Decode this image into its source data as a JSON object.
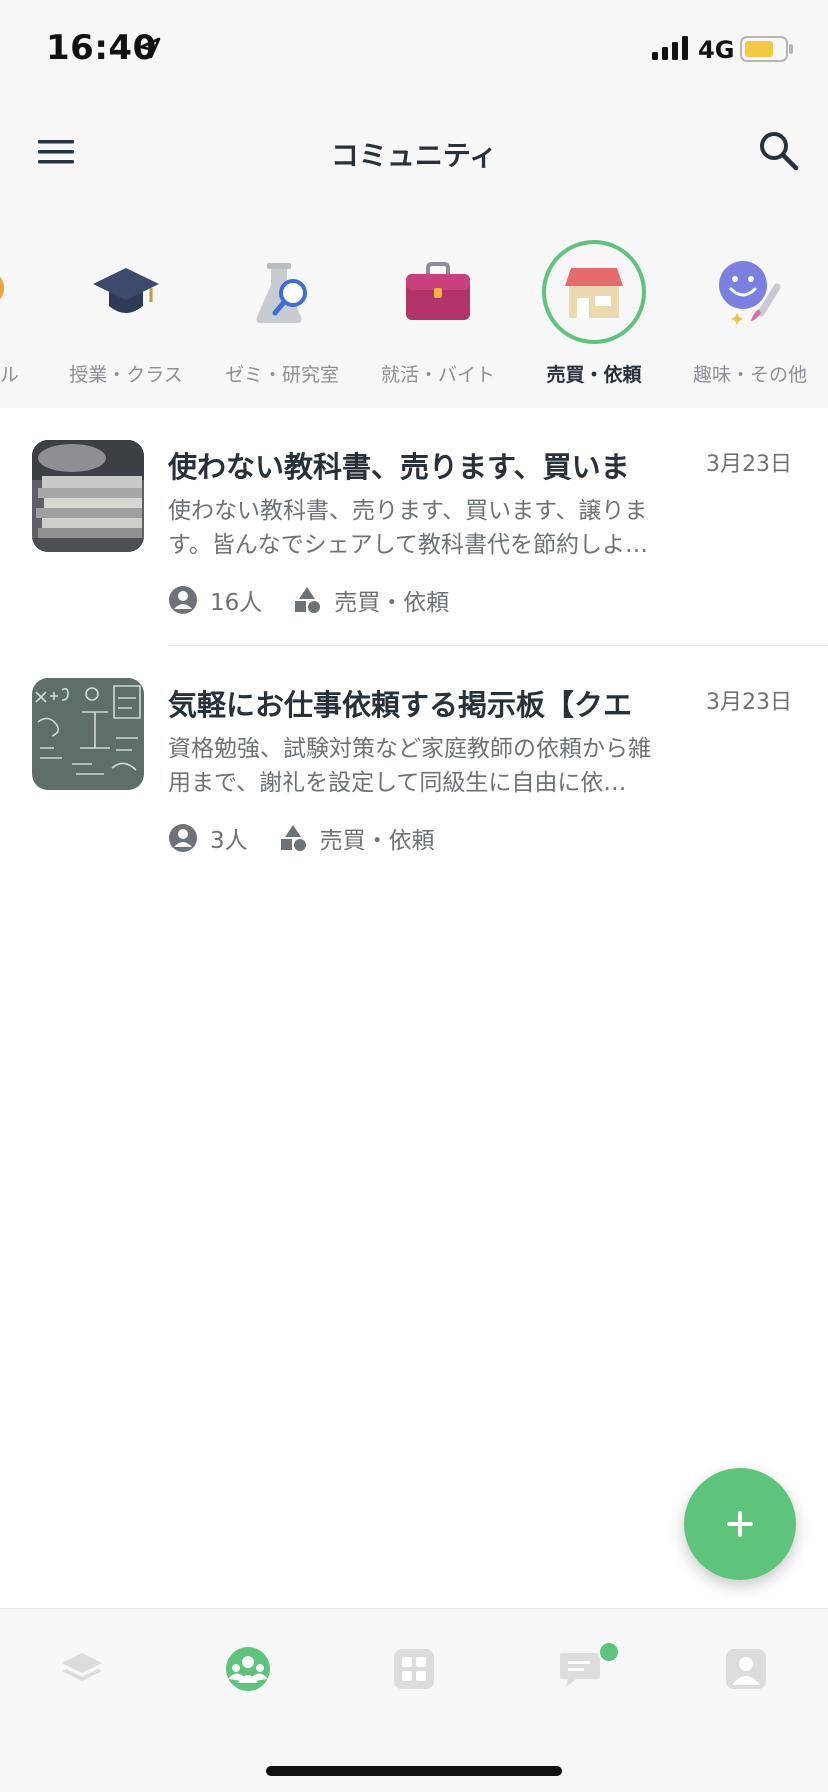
{
  "status_bar": {
    "time": "16:40",
    "network": "4G",
    "battery_color": "#f5c842"
  },
  "header": {
    "title": "コミュニティ",
    "menu_icon": "hamburger-menu-icon",
    "search_icon": "search-icon"
  },
  "categories": {
    "partial_left_label": "ル",
    "items": [
      {
        "label": "授業・クラス",
        "icon": "graduation-cap-icon",
        "active": false
      },
      {
        "label": "ゼミ・研究室",
        "icon": "flask-magnifier-icon",
        "active": false
      },
      {
        "label": "就活・バイト",
        "icon": "briefcase-icon",
        "active": false
      },
      {
        "label": "売買・依頼",
        "icon": "shop-icon",
        "active": true
      },
      {
        "label": "趣味・その他",
        "icon": "smiley-paintbrush-icon",
        "active": false
      }
    ]
  },
  "communities": [
    {
      "title": "使わない教科書、売ります、買いま",
      "date": "3月23日",
      "description": "使わない教科書、売ります、買います、譲ります。皆んなでシェアして教科書代を節約しよ…",
      "members": "16人",
      "category": "売買・依頼",
      "thumbnail": "stack-of-books-thumbnail"
    },
    {
      "title": "気軽にお仕事依頼する掲示板【クエ",
      "date": "3月23日",
      "description": "資格勉強、試験対策など家庭教師の依頼から雑用まで、謝礼を設定して同級生に自由に依…",
      "members": "3人",
      "category": "売買・依頼",
      "thumbnail": "chalkboard-formulas-thumbnail"
    }
  ],
  "fab": {
    "icon": "plus-icon",
    "color": "#5ec47c"
  },
  "tab_bar": {
    "tabs": [
      {
        "icon": "class-stack-icon",
        "active": false
      },
      {
        "icon": "community-icon",
        "active": true
      },
      {
        "icon": "grid-apps-icon",
        "active": false
      },
      {
        "icon": "chat-bubble-icon",
        "active": false,
        "badge": true
      },
      {
        "icon": "profile-icon",
        "active": false
      }
    ],
    "active_color": "#5ec47c",
    "inactive_color": "#dcdcdc"
  }
}
